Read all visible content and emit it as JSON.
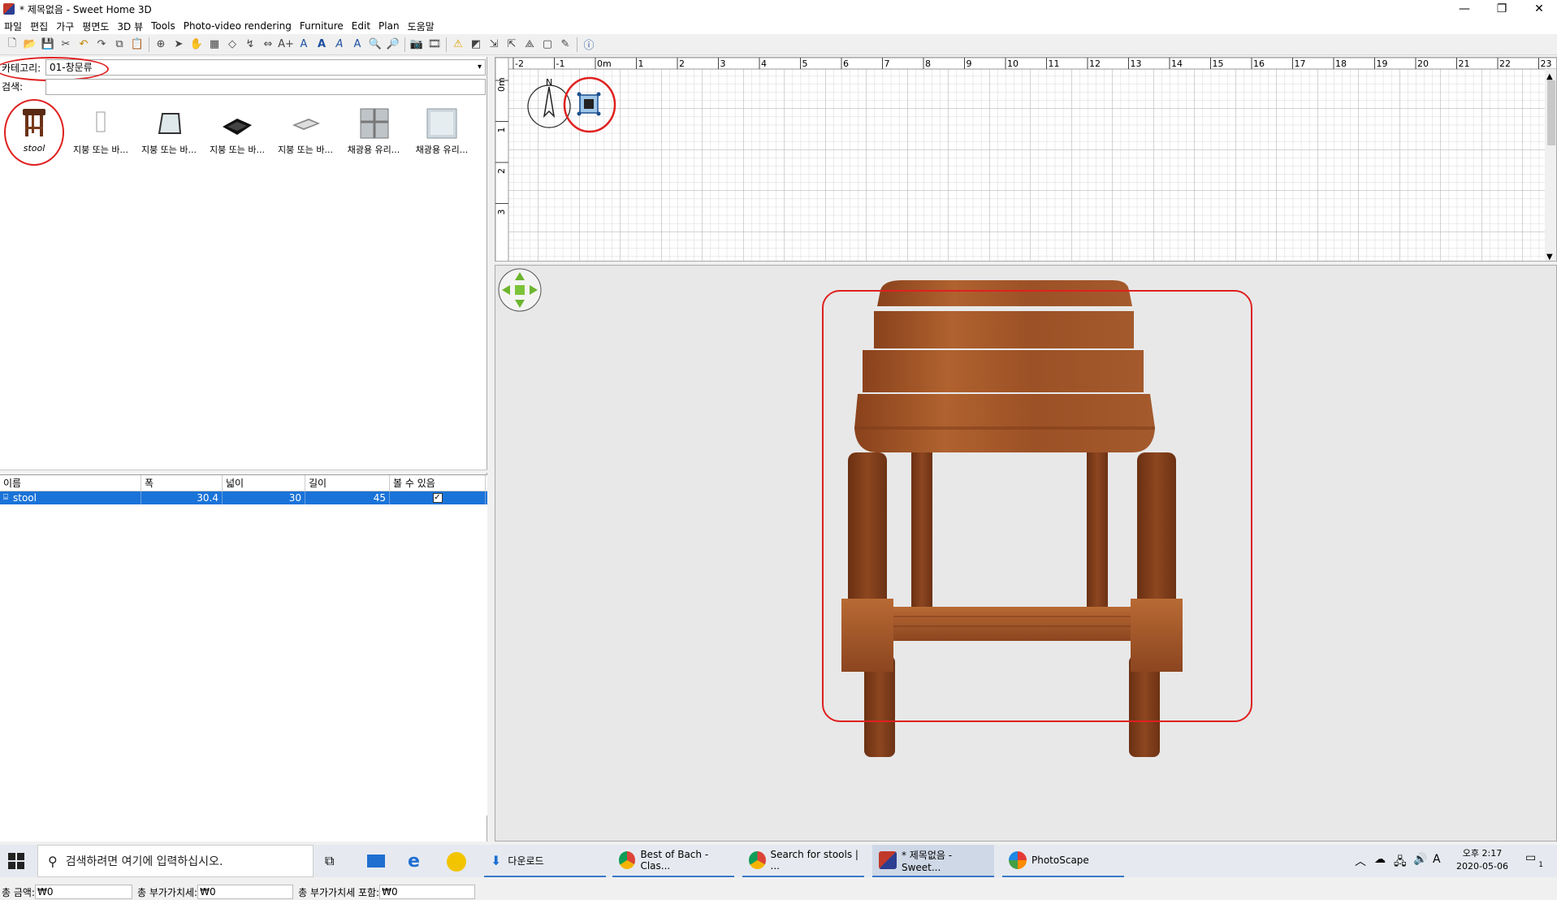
{
  "window": {
    "title": "* 제목없음 - Sweet Home 3D",
    "minimize": "—",
    "restore": "❐",
    "close": "✕"
  },
  "menu": [
    "파일",
    "편집",
    "가구",
    "평면도",
    "3D 뷰",
    "Tools",
    "Photo-video rendering",
    "Furniture",
    "Edit",
    "Plan",
    "도움말"
  ],
  "catalog": {
    "category_label": "카테고리:",
    "category_value": "01-창문류",
    "search_label": "검색:",
    "search_value": "",
    "items": [
      {
        "label": "stool"
      },
      {
        "label": "지붕 또는 바..."
      },
      {
        "label": "지붕 또는 바..."
      },
      {
        "label": "지붕 또는 바..."
      },
      {
        "label": "지붕 또는 바..."
      },
      {
        "label": "채광용 유리..."
      },
      {
        "label": "채광용 유리..."
      }
    ]
  },
  "furniture_table": {
    "columns": [
      "이름",
      "폭",
      "넓이",
      "길이",
      "볼 수 있음"
    ],
    "rows": [
      {
        "name": "stool",
        "width": "30.4",
        "depth": "30",
        "height": "45",
        "visible": true
      }
    ]
  },
  "totals": {
    "total_label": "총 금액:",
    "total_value": "₩0",
    "vat_label": "총 부가가치세:",
    "vat_value": "₩0",
    "incl_label": "총 부가가치세 포함:",
    "incl_value": "₩0"
  },
  "plan": {
    "ruler_x": [
      "-2",
      "-1",
      "0m",
      "1",
      "2",
      "3",
      "4",
      "5",
      "6",
      "7",
      "8",
      "9",
      "10",
      "11",
      "12",
      "13",
      "14",
      "15",
      "16",
      "17",
      "18",
      "19",
      "20",
      "21",
      "22",
      "23"
    ],
    "ruler_y": [
      "0m",
      "1",
      "2",
      "3"
    ],
    "compass_label": "N"
  },
  "taskbar": {
    "search_placeholder": "검색하려면 여기에 입력하십시오.",
    "apps": [
      {
        "label": "다운로드"
      },
      {
        "label": "Best of Bach - Clas..."
      },
      {
        "label": "Search for stools | ..."
      },
      {
        "label": "* 제목없음 - Sweet..."
      },
      {
        "label": "PhotoScape"
      }
    ],
    "time": "오후 2:17",
    "date": "2020-05-06",
    "ime": "A",
    "notifications": "1"
  },
  "colors": {
    "selection": "#1a73d8",
    "highlight_ring": "#e02020",
    "wood": "#9a4f24"
  }
}
